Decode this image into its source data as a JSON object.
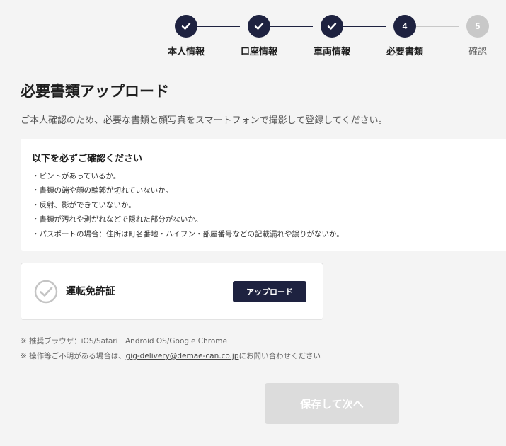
{
  "stepper": {
    "steps": [
      {
        "label": "本人情報",
        "state": "done",
        "icon": "check-icon"
      },
      {
        "label": "口座情報",
        "state": "done",
        "icon": "check-icon"
      },
      {
        "label": "車両情報",
        "state": "done",
        "icon": "check-icon"
      },
      {
        "label": "必要書類",
        "state": "current",
        "number": "4"
      },
      {
        "label": "確認",
        "state": "todo",
        "number": "5"
      }
    ]
  },
  "page": {
    "title": "必要書類アップロード",
    "lead": "ご本人確認のため、必要な書類と顔写真をスマートフォンで撮影して登録してください。"
  },
  "notice": {
    "title": "以下を必ずご確認ください",
    "items": [
      "・ピントがあっているか。",
      "・書類の端や顔の輪郭が切れていないか。",
      "・反射、影ができていないか。",
      "・書類が汚れや剥がれなどで隠れた部分がないか。",
      "・パスポートの場合：住所は町名番地・ハイフン・部屋番号などの記載漏れや誤りがないか。"
    ]
  },
  "upload": {
    "doc_name": "運転免許証",
    "button_label": "アップロード",
    "status_icon": "check-circle-icon"
  },
  "notes": {
    "browser": "※ 推奨ブラウザ：iOS/Safari　Android OS/Google Chrome",
    "contact_prefix": "※ 操作等ご不明がある場合は、",
    "contact_email": "gig-delivery@demae-can.co.jp",
    "contact_suffix": "にお問い合わせください"
  },
  "footer": {
    "save_label": "保存して次へ"
  },
  "colors": {
    "primary": "#1e2240",
    "inactive": "#c8c8c8",
    "disabled_button": "#dcdcdc",
    "background": "#f4f4f4"
  }
}
